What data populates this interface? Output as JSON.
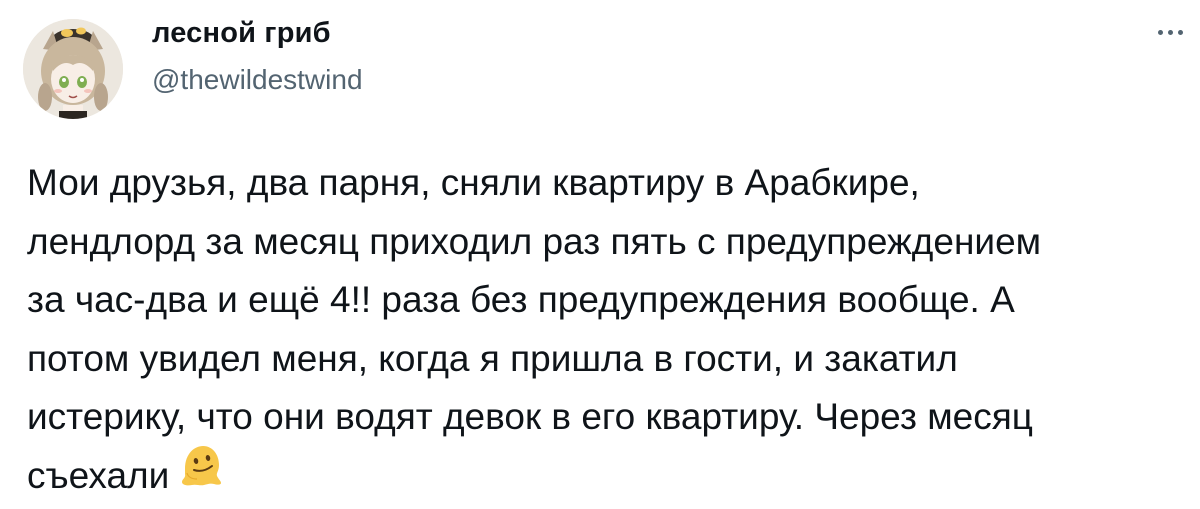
{
  "tweet": {
    "author": {
      "display_name": "лесной гриб",
      "handle": "@thewildestwind",
      "avatar_icon": "anime-girl-avatar"
    },
    "more_icon": "more-horizontal-icon",
    "text_lines": [
      "Мои друзья, два парня, сняли квартиру в Арабкире,",
      "лендлорд за месяц приходил раз пять с предупреждением",
      "за час-два и ещё 4!! раза без предупреждения вообще. А",
      "потом увидел меня, когда я пришла в гости, и закатил",
      "истерику, что они водят девок в его квартиру. Через месяц",
      "съехали"
    ],
    "emoji": "melting-face-emoji"
  },
  "colors": {
    "text": "#0f1419",
    "secondary": "#536471",
    "background": "#ffffff"
  }
}
